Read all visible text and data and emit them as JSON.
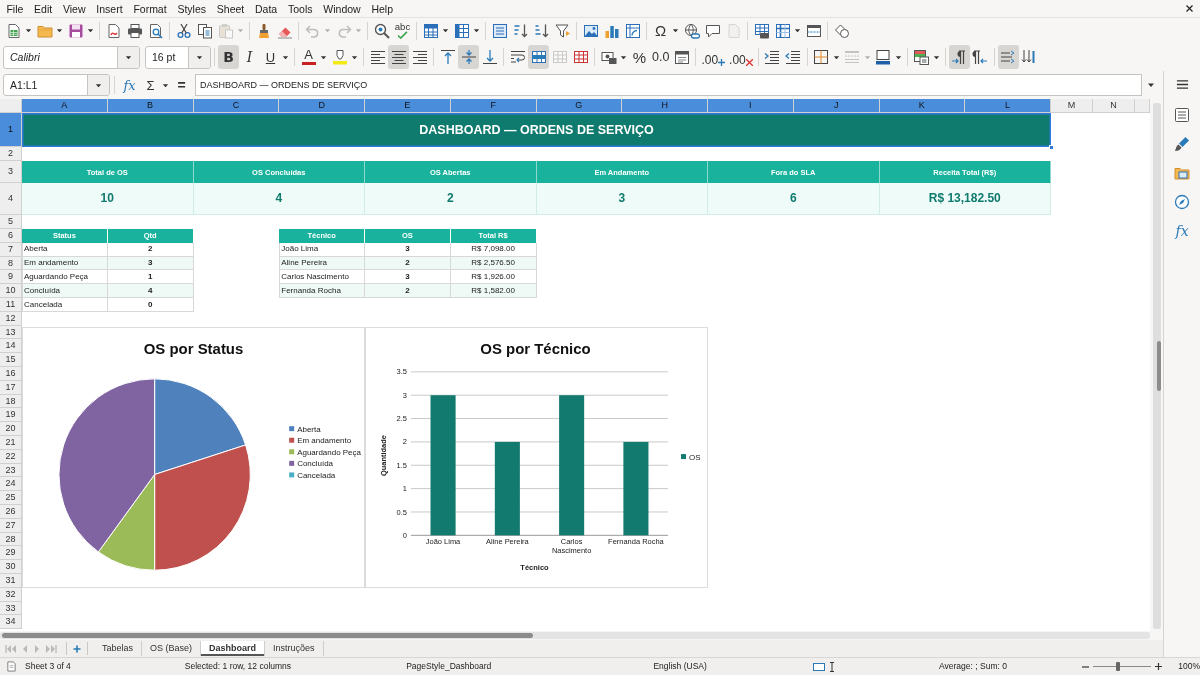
{
  "menu": [
    "File",
    "Edit",
    "View",
    "Insert",
    "Format",
    "Styles",
    "Sheet",
    "Data",
    "Tools",
    "Window",
    "Help"
  ],
  "standard_toolbar": [
    [
      {
        "kind": "new",
        "dropdown": true,
        "disabled": false
      },
      {
        "kind": "open",
        "dropdown": true,
        "disabled": false
      },
      {
        "kind": "save",
        "dropdown": true,
        "disabled": false
      }
    ],
    [
      {
        "kind": "pdf",
        "dropdown": false,
        "disabled": false
      },
      {
        "kind": "print",
        "dropdown": false,
        "disabled": false
      },
      {
        "kind": "preview",
        "dropdown": false,
        "disabled": false
      }
    ],
    [
      {
        "kind": "cut",
        "dropdown": false,
        "disabled": false
      },
      {
        "kind": "copy",
        "dropdown": false,
        "disabled": false
      },
      {
        "kind": "paste",
        "dropdown": true,
        "disabled": true
      }
    ],
    [
      {
        "kind": "clone",
        "dropdown": false,
        "disabled": false
      },
      {
        "kind": "clear",
        "dropdown": false,
        "disabled": false
      }
    ],
    [
      {
        "kind": "undo",
        "dropdown": true,
        "disabled": true
      },
      {
        "kind": "redo",
        "dropdown": true,
        "disabled": true
      }
    ],
    [
      {
        "kind": "find",
        "dropdown": false,
        "disabled": false
      },
      {
        "kind": "spelling",
        "label": "abc",
        "dropdown": false,
        "disabled": false
      }
    ],
    [
      {
        "kind": "rows",
        "dropdown": true,
        "disabled": false
      },
      {
        "kind": "columns",
        "dropdown": true,
        "disabled": false
      }
    ],
    [
      {
        "kind": "sort",
        "dropdown": false,
        "disabled": false
      },
      {
        "kind": "ascending",
        "dropdown": false,
        "disabled": false
      },
      {
        "kind": "descending",
        "dropdown": false,
        "disabled": false
      },
      {
        "kind": "filter",
        "dropdown": false,
        "disabled": false
      }
    ],
    [
      {
        "kind": "image",
        "dropdown": false,
        "disabled": false
      },
      {
        "kind": "chart",
        "dropdown": false,
        "disabled": false
      },
      {
        "kind": "pivot",
        "dropdown": false,
        "disabled": false
      }
    ],
    [
      {
        "kind": "special",
        "label": "Ω",
        "dropdown": true,
        "disabled": false
      },
      {
        "kind": "hyperlink",
        "dropdown": false,
        "disabled": false
      },
      {
        "kind": "comment",
        "dropdown": false,
        "disabled": false
      },
      {
        "kind": "headerfooter",
        "dropdown": false,
        "disabled": true
      }
    ],
    [
      {
        "kind": "printarea",
        "dropdown": false,
        "disabled": false
      },
      {
        "kind": "freeze",
        "dropdown": true,
        "disabled": false
      },
      {
        "kind": "split",
        "dropdown": false,
        "disabled": false
      }
    ],
    [
      {
        "kind": "shapes",
        "dropdown": false,
        "disabled": false
      }
    ]
  ],
  "format_toolbar": {
    "font_name": "Calibri",
    "font_size": "16 pt",
    "groups": [
      [
        {
          "kind": "bold",
          "label": "B",
          "pressed": true,
          "dropdown": false,
          "disabled": false
        },
        {
          "kind": "italic",
          "label": "I",
          "pressed": false,
          "dropdown": false,
          "disabled": false
        },
        {
          "kind": "underline",
          "label": "U",
          "pressed": false,
          "dropdown": true,
          "disabled": false
        }
      ],
      [
        {
          "kind": "fontcolor",
          "label": "A",
          "pressed": false,
          "dropdown": true,
          "disabled": false
        },
        {
          "kind": "highlight",
          "pressed": false,
          "dropdown": true,
          "disabled": false
        }
      ],
      [
        {
          "kind": "left",
          "pressed": false,
          "dropdown": false,
          "disabled": false
        },
        {
          "kind": "center",
          "pressed": true,
          "dropdown": false,
          "disabled": false
        },
        {
          "kind": "right",
          "pressed": false,
          "dropdown": false,
          "disabled": false
        }
      ],
      [
        {
          "kind": "top",
          "pressed": false,
          "dropdown": false,
          "disabled": false
        },
        {
          "kind": "middle",
          "pressed": true,
          "dropdown": false,
          "disabled": false
        },
        {
          "kind": "bottom",
          "pressed": false,
          "dropdown": false,
          "disabled": false
        }
      ],
      [
        {
          "kind": "wrap",
          "pressed": false,
          "dropdown": false,
          "disabled": false
        },
        {
          "kind": "mergecenter",
          "pressed": true,
          "dropdown": false,
          "disabled": false
        },
        {
          "kind": "merge",
          "pressed": false,
          "dropdown": false,
          "disabled": true
        },
        {
          "kind": "unmerge",
          "pressed": false,
          "dropdown": false,
          "disabled": false
        }
      ],
      [
        {
          "kind": "currency",
          "pressed": false,
          "dropdown": true,
          "disabled": false
        },
        {
          "kind": "percent",
          "label": "%",
          "pressed": false,
          "dropdown": false,
          "disabled": false
        },
        {
          "kind": "number",
          "label": "0.0",
          "pressed": false,
          "dropdown": false,
          "disabled": false
        },
        {
          "kind": "date",
          "pressed": false,
          "dropdown": false,
          "disabled": false
        }
      ],
      [
        {
          "kind": "adddecimal",
          "label": ".00",
          "pressed": false,
          "dropdown": false,
          "disabled": false
        },
        {
          "kind": "deldecimal",
          "label": ".00",
          "pressed": false,
          "dropdown": false,
          "disabled": false
        }
      ],
      [
        {
          "kind": "indent",
          "pressed": false,
          "dropdown": false,
          "disabled": false
        },
        {
          "kind": "outdent",
          "pressed": false,
          "dropdown": false,
          "disabled": false
        }
      ],
      [
        {
          "kind": "borders",
          "pressed": false,
          "dropdown": true,
          "disabled": false
        },
        {
          "kind": "borderstyle",
          "pressed": false,
          "dropdown": true,
          "disabled": true
        },
        {
          "kind": "bordercolor",
          "pressed": false,
          "dropdown": true,
          "disabled": false
        }
      ],
      [
        {
          "kind": "conditional",
          "pressed": false,
          "dropdown": true,
          "disabled": false
        }
      ],
      [
        {
          "kind": "ltr",
          "pressed": true,
          "dropdown": false,
          "disabled": false
        },
        {
          "kind": "rtl",
          "pressed": false,
          "dropdown": false,
          "disabled": false
        }
      ],
      [
        {
          "kind": "textflow",
          "pressed": true,
          "dropdown": false,
          "disabled": false
        },
        {
          "kind": "vertical",
          "pressed": false,
          "dropdown": false,
          "disabled": false
        }
      ]
    ]
  },
  "formula_bar": {
    "name_box": "A1:L1",
    "function_wizard": "fx",
    "sum": "Σ",
    "equals": "=",
    "content": "DASHBOARD — ORDENS DE SERVIÇO"
  },
  "sheet": {
    "columns": [
      {
        "label": "A",
        "selected": true
      },
      {
        "label": "B",
        "selected": true
      },
      {
        "label": "C",
        "selected": true
      },
      {
        "label": "D",
        "selected": true
      },
      {
        "label": "E",
        "selected": true
      },
      {
        "label": "F",
        "selected": true
      },
      {
        "label": "G",
        "selected": true
      },
      {
        "label": "H",
        "selected": true
      },
      {
        "label": "I",
        "selected": true
      },
      {
        "label": "J",
        "selected": true
      },
      {
        "label": "K",
        "selected": true
      },
      {
        "label": "L",
        "selected": true
      },
      {
        "label": "M",
        "selected": false
      },
      {
        "label": "N",
        "selected": false
      }
    ],
    "rows": [
      {
        "label": "1",
        "selected": true
      },
      {
        "label": "2",
        "selected": false
      },
      {
        "label": "3",
        "selected": false
      },
      {
        "label": "4",
        "selected": false
      },
      {
        "label": "5",
        "selected": false
      },
      {
        "label": "6",
        "selected": false
      },
      {
        "label": "7",
        "selected": false
      },
      {
        "label": "8",
        "selected": false
      },
      {
        "label": "9",
        "selected": false
      },
      {
        "label": "10",
        "selected": false
      },
      {
        "label": "11",
        "selected": false
      },
      {
        "label": "12",
        "selected": false
      },
      {
        "label": "13",
        "selected": false
      },
      {
        "label": "14",
        "selected": false
      },
      {
        "label": "15",
        "selected": false
      },
      {
        "label": "16",
        "selected": false
      },
      {
        "label": "17",
        "selected": false
      },
      {
        "label": "18",
        "selected": false
      },
      {
        "label": "19",
        "selected": false
      },
      {
        "label": "20",
        "selected": false
      },
      {
        "label": "21",
        "selected": false
      },
      {
        "label": "22",
        "selected": false
      },
      {
        "label": "23",
        "selected": false
      },
      {
        "label": "24",
        "selected": false
      },
      {
        "label": "25",
        "selected": false
      },
      {
        "label": "26",
        "selected": false
      },
      {
        "label": "27",
        "selected": false
      },
      {
        "label": "28",
        "selected": false
      },
      {
        "label": "29",
        "selected": false
      },
      {
        "label": "30",
        "selected": false
      },
      {
        "label": "31",
        "selected": false
      },
      {
        "label": "32",
        "selected": false
      },
      {
        "label": "33",
        "selected": false
      },
      {
        "label": "34",
        "selected": false
      }
    ],
    "title": {
      "text": "DASHBOARD — ORDENS DE SERVIÇO",
      "selected": true
    },
    "kpis": [
      {
        "label": "Total de OS",
        "value": "10"
      },
      {
        "label": "OS Concluídas",
        "value": "4"
      },
      {
        "label": "OS Abertas",
        "value": "2"
      },
      {
        "label": "Em Andamento",
        "value": "3"
      },
      {
        "label": "Fora do SLA",
        "value": "6"
      },
      {
        "label": "Receita Total (R$)",
        "value": "R$ 13,182.50"
      }
    ],
    "status_table": {
      "columns": [
        "Status",
        "Qtd"
      ],
      "rows": [
        [
          "Aberta",
          "2"
        ],
        [
          "Em andamento",
          "3"
        ],
        [
          "Aguardando Peça",
          "1"
        ],
        [
          "Concluída",
          "4"
        ],
        [
          "Cancelada",
          "0"
        ]
      ]
    },
    "technician_table": {
      "columns": [
        "Técnico",
        "OS",
        "Total R$"
      ],
      "rows": [
        [
          "João Lima",
          "3",
          "R$ 7,098.00"
        ],
        [
          "Aline Pereira",
          "2",
          "R$ 2,576.50"
        ],
        [
          "Carlos Nascimento",
          "3",
          "R$ 1,926.00"
        ],
        [
          "Fernanda Rocha",
          "2",
          "R$ 1,582.00"
        ]
      ]
    },
    "status_chart": {
      "chart_data": {
        "type": "pie",
        "title": "OS por Status",
        "categories": [
          "Aberta",
          "Em andamento",
          "Aguardando Peça",
          "Concluída",
          "Cancelada"
        ],
        "values": [
          20,
          30,
          10,
          40,
          0
        ],
        "colors": [
          "#4f81bd",
          "#c0504d",
          "#9bbb59",
          "#8064a2",
          "#4bacc6"
        ],
        "legend": "right"
      }
    },
    "technician_chart": {
      "chart_data": {
        "type": "bar",
        "title": "OS por Técnico",
        "xlabel": "Técnico",
        "ylabel": "Quantidade",
        "categories": [
          "João Lima",
          "Aline Pereira",
          "Carlos Nascimento",
          "Fernanda Rocha"
        ],
        "series": [
          {
            "name": "OS",
            "color": "#127a6e",
            "values": [
              3,
              2,
              3,
              2
            ]
          }
        ],
        "ylim": [
          0,
          3.5
        ],
        "yticks": [
          0,
          0.5,
          1,
          1.5,
          2,
          2.5,
          3,
          3.5
        ],
        "grid": true,
        "legend": "right"
      }
    }
  },
  "sheet_nav": [
    {
      "kind": "first",
      "disabled": true
    },
    {
      "kind": "previous",
      "disabled": true
    },
    {
      "kind": "next",
      "disabled": true
    },
    {
      "kind": "last",
      "disabled": true
    }
  ],
  "sheet_tabs": [
    {
      "label": "Tabelas",
      "selected": false
    },
    {
      "label": "OS (Base)",
      "selected": false
    },
    {
      "label": "Dashboard",
      "selected": true
    },
    {
      "label": "Instruções",
      "selected": false
    }
  ],
  "sidebar": [
    {
      "kind": "properties"
    },
    {
      "kind": "styles"
    },
    {
      "kind": "gallery"
    },
    {
      "kind": "navigator"
    },
    {
      "kind": "functions",
      "label": "fx"
    }
  ],
  "status_bar": {
    "sheet": "Sheet 3 of 4",
    "selection": "Selected: 1 row, 12 columns",
    "page_style": "PageStyle_Dashboard",
    "language": "English (USA)",
    "summary": "Average: ; Sum: 0",
    "zoom": {
      "level": 0.43,
      "label": "100%"
    }
  }
}
